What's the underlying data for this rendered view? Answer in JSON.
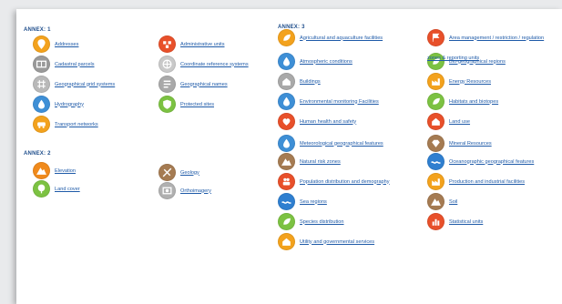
{
  "annex1": {
    "heading": "ANNEX: 1",
    "items": [
      {
        "label": "Addresses",
        "color": "#f3a21d"
      },
      {
        "label": "Administrative units",
        "color": "#e8502a"
      },
      {
        "label": "Cadastral parcels",
        "color": "#9a9a9a"
      },
      {
        "label": "Coordinate reference systems",
        "color": "#c9c9c9"
      },
      {
        "label": "Geographical grid systems",
        "color": "#b9b9b9"
      },
      {
        "label": "Geographical names",
        "color": "#a9a9a9"
      },
      {
        "label": "Hydrography",
        "color": "#3e8fd6"
      },
      {
        "label": "Protected sites",
        "color": "#7cc242"
      },
      {
        "label": "Transport networks",
        "color": "#f3a21d"
      }
    ]
  },
  "annex2": {
    "heading": "ANNEX: 2",
    "items": [
      {
        "label": "Elevation",
        "color": "#f08a1c"
      },
      {
        "label": "Geology",
        "color": "#a57b52"
      },
      {
        "label": "Land cover",
        "color": "#7cc242"
      },
      {
        "label": "Orthoimagery",
        "color": "#b0b0b0"
      }
    ]
  },
  "annex3": {
    "heading": "ANNEX: 3",
    "items": [
      {
        "label": "Agricultural and aquaculture facilities",
        "color": "#f3a21d"
      },
      {
        "label": "Area management / restriction / regulation",
        "label_cont": "zones & reporting units",
        "color": "#e8502a"
      },
      {
        "label": "Atmospheric conditions",
        "color": "#3e8fd6"
      },
      {
        "label": "Bio-geographical regions",
        "color": "#7cc242"
      },
      {
        "label": "Buildings",
        "color": "#a9a9a9"
      },
      {
        "label": "Energy Resources",
        "color": "#f3a21d"
      },
      {
        "label": "Environmental monitoring Facilities",
        "color": "#3e8fd6"
      },
      {
        "label": "Habitats and biotopes",
        "color": "#7cc242"
      },
      {
        "label": "Human health and safety",
        "color": "#e8502a"
      },
      {
        "label": "Land use",
        "color": "#e8502a"
      },
      {
        "label": "Meteorological geographical features",
        "color": "#3e8fd6"
      },
      {
        "label": "Mineral Resources",
        "color": "#a57b52"
      },
      {
        "label": "Natural risk zones",
        "color": "#a57b52"
      },
      {
        "label": "Oceanographic geographical features",
        "color": "#2f7fd0"
      },
      {
        "label": "Population distribution and demography",
        "color": "#e8502a"
      },
      {
        "label": "Production and industrial facilities",
        "color": "#f3a21d"
      },
      {
        "label": "Sea regions",
        "color": "#2f7fd0"
      },
      {
        "label": "Soil",
        "color": "#a57b52"
      },
      {
        "label": "Species distribution",
        "color": "#7cc242"
      },
      {
        "label": "Statistical units",
        "color": "#e8502a"
      },
      {
        "label": "Utility and governmental services",
        "color": "#f3a21d"
      }
    ]
  }
}
